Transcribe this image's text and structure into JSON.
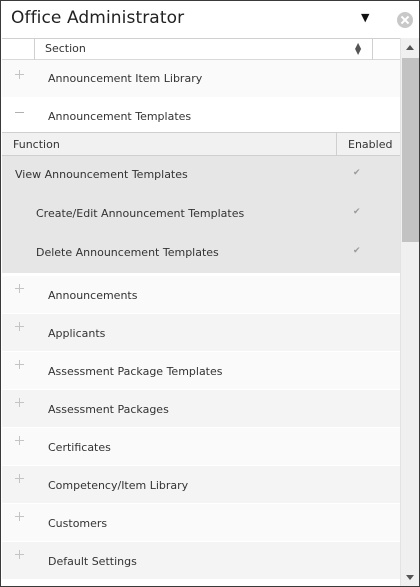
{
  "header": {
    "role_value": "Office Administrator"
  },
  "grid": {
    "section_header": "Section",
    "rows_top": [
      {
        "label": "Announcement Item Library",
        "state": "collapsed"
      },
      {
        "label": "Announcement Templates",
        "state": "expanded"
      }
    ],
    "expanded": {
      "function_header": "Function",
      "enabled_header": "Enabled",
      "functions": [
        {
          "name": "View Announcement Templates",
          "enabled": true,
          "level": 0
        },
        {
          "name": "Create/Edit Announcement Templates",
          "enabled": true,
          "level": 1
        },
        {
          "name": "Delete Announcement Templates",
          "enabled": true,
          "level": 1
        }
      ]
    },
    "rows_bottom": [
      {
        "label": "Announcements"
      },
      {
        "label": "Applicants"
      },
      {
        "label": "Assessment Package Templates"
      },
      {
        "label": "Assessment Packages"
      },
      {
        "label": "Certificates"
      },
      {
        "label": "Competency/Item Library"
      },
      {
        "label": "Customers"
      },
      {
        "label": "Default Settings"
      }
    ]
  },
  "icons": {
    "dropdown": "caret-down-icon",
    "close": "close-circle-icon",
    "sort": "sort-icon",
    "expand": "plus-icon",
    "collapse": "minus-icon",
    "check": "checkmark-icon"
  },
  "glyphs": {
    "caret": "▼",
    "check": "✔"
  }
}
